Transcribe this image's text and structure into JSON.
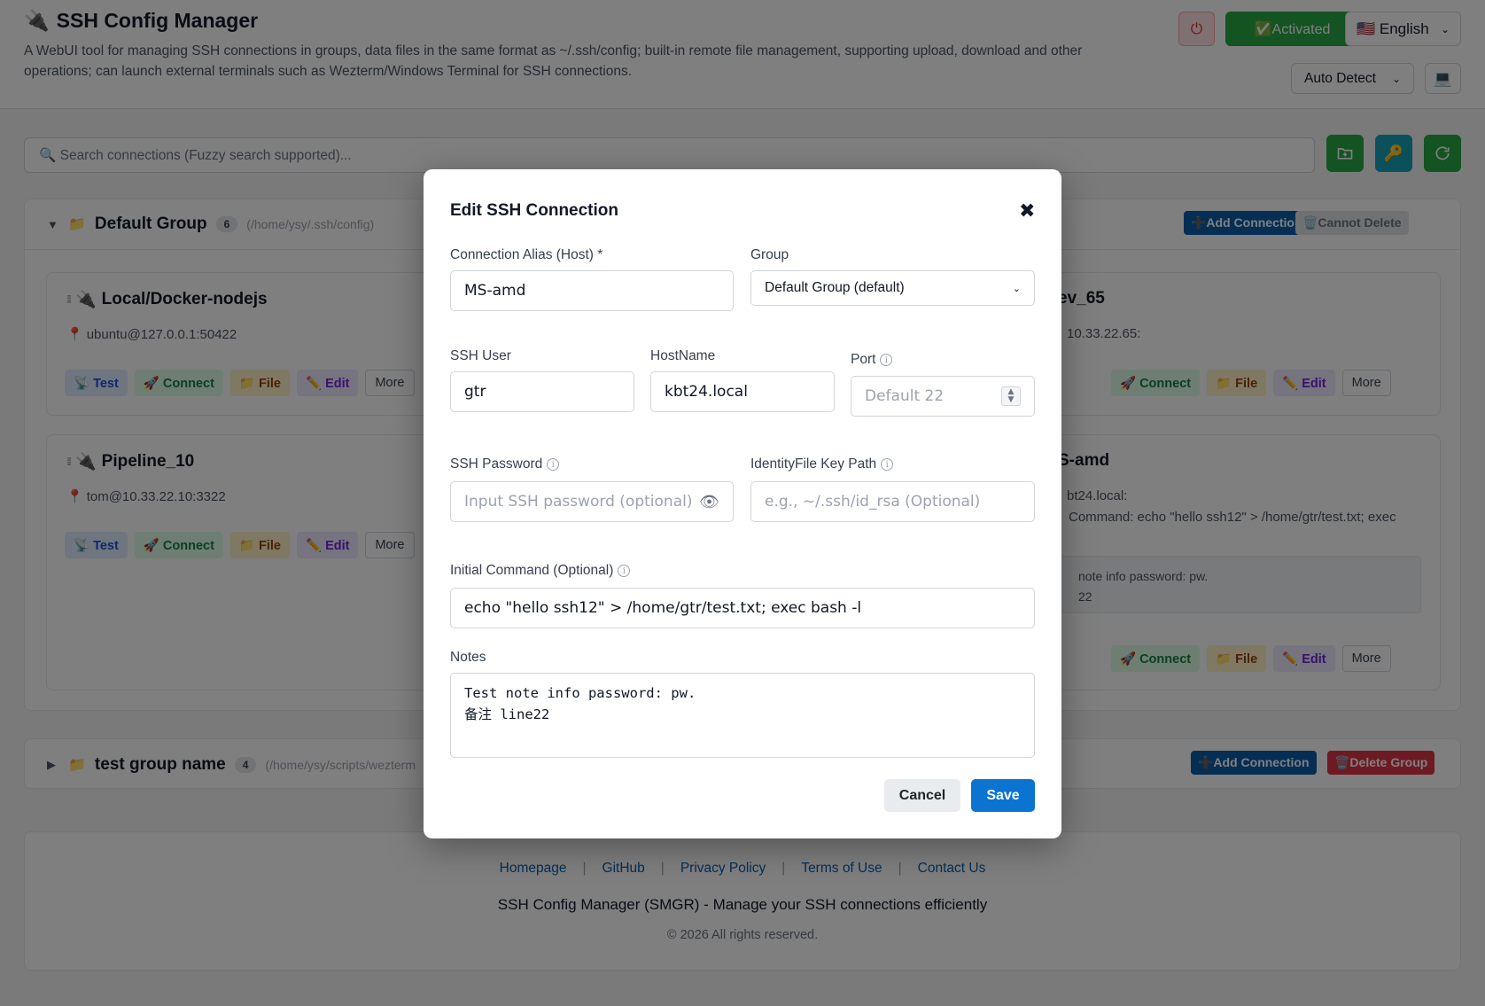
{
  "header": {
    "title": "SSH Config Manager",
    "description": "A WebUI tool for managing SSH connections in groups, data files in the same format as ~/.ssh/config; built-in remote file management, supporting upload, download and other operations; can launch external terminals such as Wezterm/Windows Terminal for SSH connections.",
    "activated_label": "✅Activated",
    "language": "🇺🇸 English",
    "terminal_mode": "Auto Detect"
  },
  "search": {
    "placeholder": "🔍 Search connections (Fuzzy search supported)..."
  },
  "groups": [
    {
      "name": "Default Group",
      "count": "6",
      "path": "(/home/ysy/.ssh/config)",
      "add_label": "➕Add Connection",
      "delete_label": "🗑️Cannot Delete"
    },
    {
      "name": "test group name",
      "count": "4",
      "path": "(/home/ysy/scripts/wezterm",
      "add_label": "➕Add Connection",
      "delete_label": "🗑️Delete Group"
    }
  ],
  "cards": [
    {
      "name": "Local/Docker-nodejs",
      "address": "ubuntu@127.0.0.1:50422"
    },
    {
      "name": "Pipeline_10",
      "address": "tom@10.33.22.10:3322"
    },
    {
      "name": "ev_65",
      "address": "10.33.22.65:"
    },
    {
      "name": "S-amd",
      "address": "bt24.local:",
      "command": "Command: echo \"hello ssh12\" > /home/gtr/test.txt; exec",
      "note_line1": "note info password: pw.",
      "note_line2": "22"
    }
  ],
  "actions": {
    "test": "📡 Test",
    "connect": "🚀 Connect",
    "file": "📁 File",
    "edit": "✏️ Edit",
    "more": "More"
  },
  "footer": {
    "links": [
      "Homepage",
      "GitHub",
      "Privacy Policy",
      "Terms of Use",
      "Contact Us"
    ],
    "tagline": "SSH Config Manager (SMGR) - Manage your SSH connections efficiently",
    "copyright": "© 2026 All rights reserved."
  },
  "modal": {
    "title": "Edit SSH Connection",
    "close": "✖",
    "alias_label": "Connection Alias (Host) *",
    "alias_value": "MS-amd",
    "group_label": "Group",
    "group_value": "Default Group (default)",
    "user_label": "SSH User",
    "user_value": "gtr",
    "hostname_label": "HostName",
    "hostname_value": "kbt24.local",
    "port_label": "Port",
    "port_placeholder": "Default 22",
    "password_label": "SSH Password",
    "password_placeholder": "Input SSH password (optional)",
    "identity_label": "IdentityFile Key Path",
    "identity_placeholder": "e.g., ~/.ssh/id_rsa (Optional)",
    "initcmd_label": "Initial Command (Optional)",
    "initcmd_value": "echo \"hello ssh12\" > /home/gtr/test.txt; exec bash -l",
    "notes_label": "Notes",
    "notes_value": "Test note info password: pw.\n备注 line22",
    "cancel": "Cancel",
    "save": "Save"
  }
}
